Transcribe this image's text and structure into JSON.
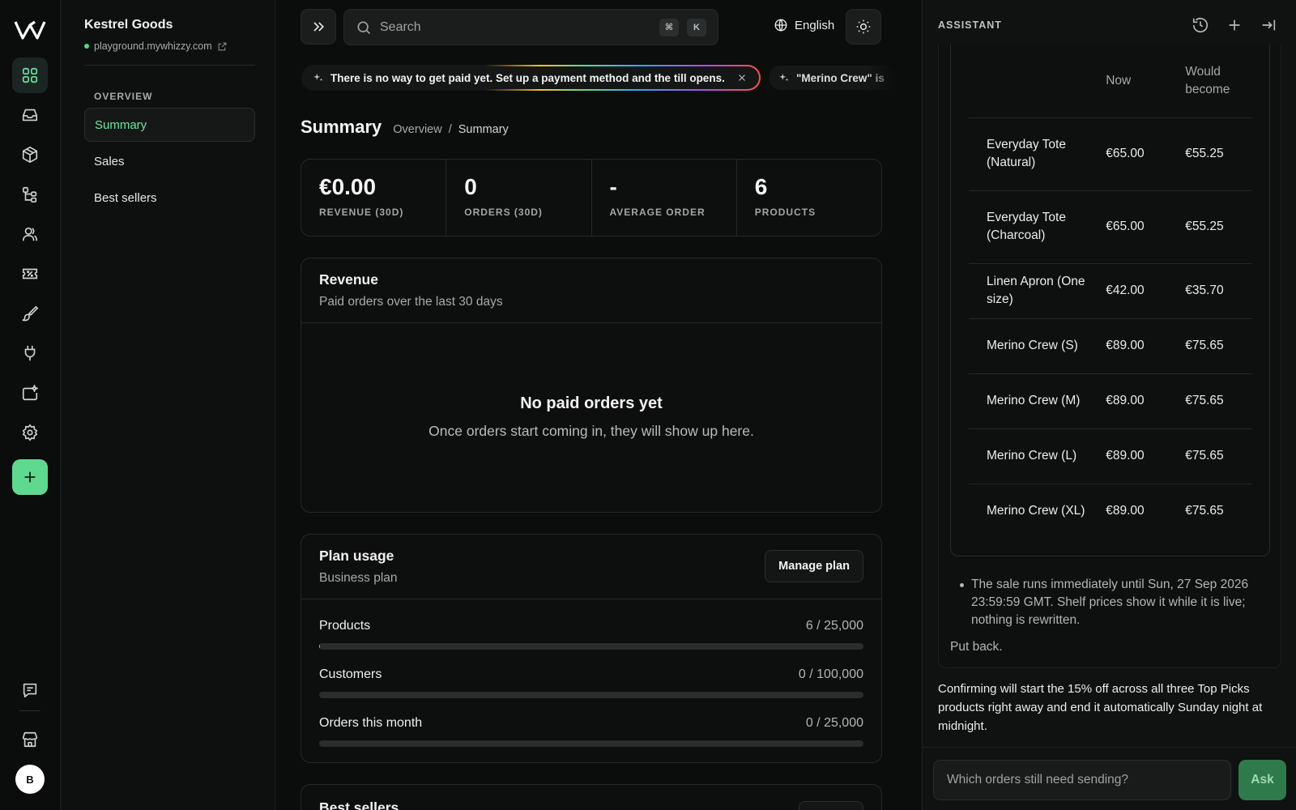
{
  "store": {
    "name": "Kestrel Goods",
    "url": "playground.mywhizzy.com"
  },
  "sidebar": {
    "section": "OVERVIEW",
    "items": [
      {
        "label": "Summary",
        "active": true
      },
      {
        "label": "Sales"
      },
      {
        "label": "Best sellers"
      }
    ]
  },
  "rail": {
    "icons": [
      "grid-icon",
      "inbox-icon",
      "box-icon",
      "hierarchy-icon",
      "users-icon",
      "ticket-icon",
      "brush-icon",
      "plug-icon",
      "sparkle-box-icon",
      "gear-icon",
      "plus-icon",
      "chat-icon",
      "storefront-icon"
    ],
    "avatar_letter": "B"
  },
  "topbar": {
    "search_placeholder": "Search",
    "kbd": [
      "⌘",
      "K"
    ],
    "language": "English"
  },
  "banner": {
    "text": "There is no way to get paid yet. Set up a payment method and the till opens.",
    "second": "\"Merino Crew\" is"
  },
  "page": {
    "title": "Summary",
    "breadcrumb": [
      "Overview",
      "Summary"
    ]
  },
  "stats": [
    {
      "value": "€0.00",
      "label": "REVENUE (30D)"
    },
    {
      "value": "0",
      "label": "ORDERS (30D)"
    },
    {
      "value": "-",
      "label": "AVERAGE ORDER"
    },
    {
      "value": "6",
      "label": "PRODUCTS"
    }
  ],
  "revenue": {
    "title": "Revenue",
    "subtitle": "Paid orders over the last 30 days",
    "empty_title": "No paid orders yet",
    "empty_text": "Once orders start coming in, they will show up here."
  },
  "plan": {
    "title": "Plan usage",
    "subtitle": "Business plan",
    "button": "Manage plan",
    "usage": [
      {
        "name": "Products",
        "count": "6 / 25,000",
        "fill": 0.00024
      },
      {
        "name": "Customers",
        "count": "0 / 100,000",
        "fill": 0
      },
      {
        "name": "Orders this month",
        "count": "0 / 25,000",
        "fill": 0
      }
    ]
  },
  "best": {
    "title": "Best sellers"
  },
  "assistant": {
    "header": "ASSISTANT",
    "table": {
      "headers": [
        "",
        "Now",
        "Would become"
      ],
      "rows": [
        [
          "Everyday Tote (Natural)",
          "€65.00",
          "€55.25"
        ],
        [
          "Everyday Tote (Charcoal)",
          "€65.00",
          "€55.25"
        ],
        [
          "Linen Apron (One size)",
          "€42.00",
          "€35.70"
        ],
        [
          "Merino Crew (S)",
          "€89.00",
          "€75.65"
        ],
        [
          "Merino Crew (M)",
          "€89.00",
          "€75.65"
        ],
        [
          "Merino Crew (L)",
          "€89.00",
          "€75.65"
        ],
        [
          "Merino Crew (XL)",
          "€89.00",
          "€75.65"
        ]
      ]
    },
    "bullet": "The sale runs immediately until Sun, 27 Sep 2026 23:59:59 GMT. Shelf prices show it while it is live; nothing is rewritten.",
    "put_back": "Put back.",
    "reply": "Confirming will start the 15% off across all three Top Picks products right away and end it automatically Sunday night at midnight.",
    "input_placeholder": "Which orders still need sending?",
    "ask": "Ask"
  },
  "colors": {
    "accent": "#5fd890",
    "accent_text": "#6fe3a0",
    "background": "#0b0c0c",
    "ask_button": "#2f7a4a"
  }
}
